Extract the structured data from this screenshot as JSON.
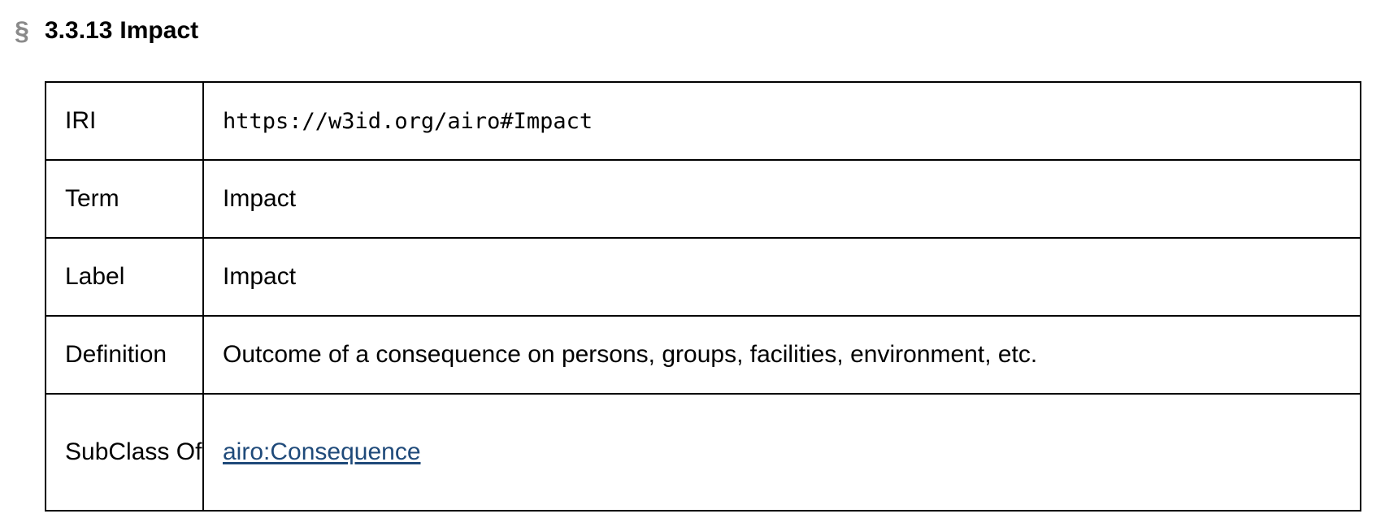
{
  "section": {
    "anchor_symbol": "§",
    "number": "3.3.13",
    "title": "Impact"
  },
  "table": {
    "iri": {
      "label": "IRI",
      "value": "https://w3id.org/airo#Impact"
    },
    "term": {
      "label": "Term",
      "value": "Impact"
    },
    "rdfs_label": {
      "label": "Label",
      "value": "Impact"
    },
    "definition": {
      "label": "Definition",
      "value": "Outcome of a consequence on persons, groups, facilities, environment, etc."
    },
    "subclass_of": {
      "label": "SubClass Of",
      "value": "airo:Consequence"
    }
  },
  "colors": {
    "link": "#1f4a7a",
    "anchor_symbol": "#8a8a8a",
    "border": "#000000"
  }
}
